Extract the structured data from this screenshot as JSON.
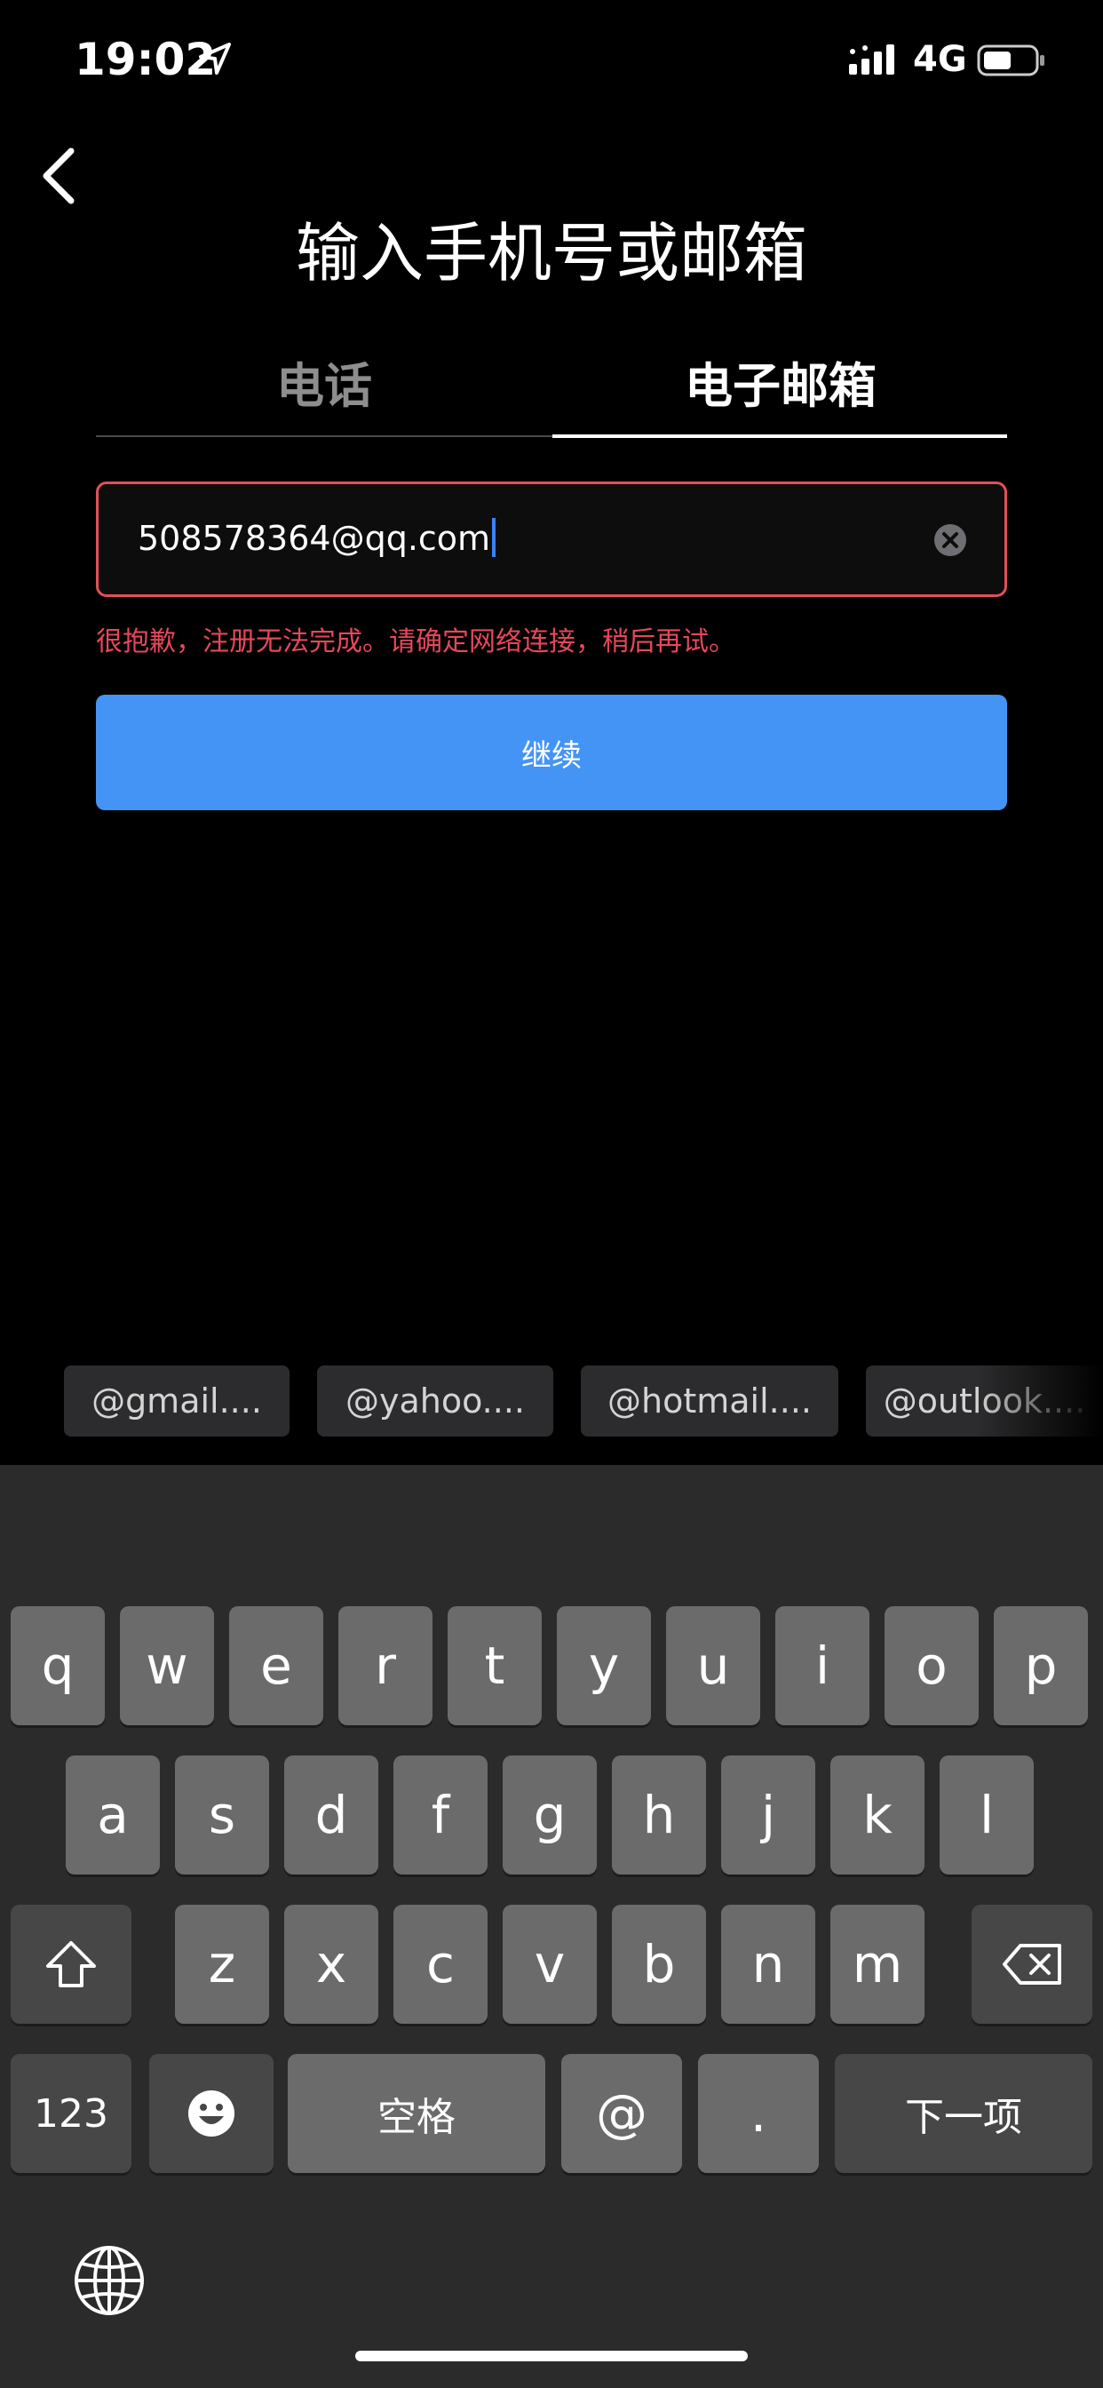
{
  "status_bar": {
    "time": "19:02",
    "network": "4G"
  },
  "header": {
    "title": "输入手机号或邮箱"
  },
  "tabs": [
    {
      "label": "电话"
    },
    {
      "label": "电子邮箱"
    }
  ],
  "form": {
    "email_value": "508578364@qq.com",
    "error": "很抱歉，注册无法完成。请确定网络连接，稍后再试。",
    "continue_label": "继续"
  },
  "suggestions": [
    "@gmail....",
    "@yahoo....",
    "@hotmail....",
    "@outlook...."
  ],
  "keyboard": {
    "row1": [
      "q",
      "w",
      "e",
      "r",
      "t",
      "y",
      "u",
      "i",
      "o",
      "p"
    ],
    "row2": [
      "a",
      "s",
      "d",
      "f",
      "g",
      "h",
      "j",
      "k",
      "l"
    ],
    "row3": [
      "z",
      "x",
      "c",
      "v",
      "b",
      "n",
      "m"
    ],
    "numbers_label": "123",
    "space_label": "空格",
    "at_label": "@",
    "dot_label": ".",
    "next_label": "下一项"
  },
  "colors": {
    "accent": "#4494f5",
    "error": "#e5485a",
    "background": "#000000"
  }
}
